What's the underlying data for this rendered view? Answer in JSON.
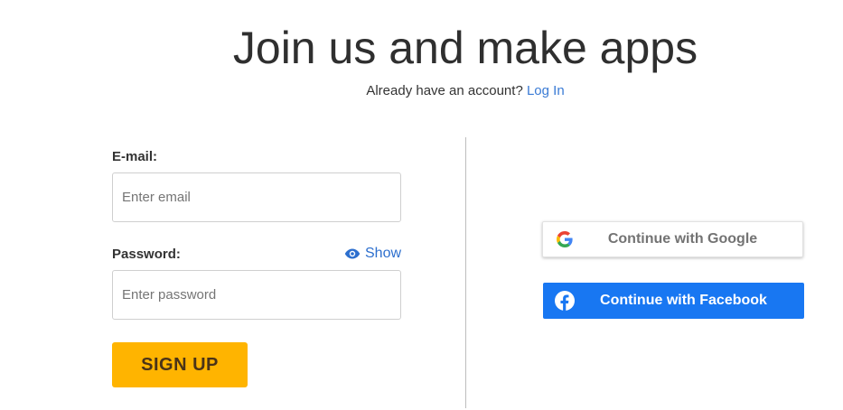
{
  "header": {
    "title": "Join us and make apps",
    "subtitle_text": "Already have an account?",
    "login_link": "Log In"
  },
  "form": {
    "email": {
      "label": "E-mail:",
      "placeholder": "Enter email",
      "value": ""
    },
    "password": {
      "label": "Password:",
      "placeholder": "Enter password",
      "value": "",
      "show_toggle": "Show",
      "show_icon": "eye-icon"
    },
    "submit_label": "SIGN UP",
    "submit_color": "#ffb400"
  },
  "social": {
    "google": {
      "label": "Continue with Google",
      "icon": "google-icon"
    },
    "facebook": {
      "label": "Continue with Facebook",
      "icon": "facebook-icon",
      "color": "#1877f2"
    }
  },
  "colors": {
    "link": "#3a7bd5",
    "accent": "#ffb400",
    "facebook": "#1877f2"
  }
}
